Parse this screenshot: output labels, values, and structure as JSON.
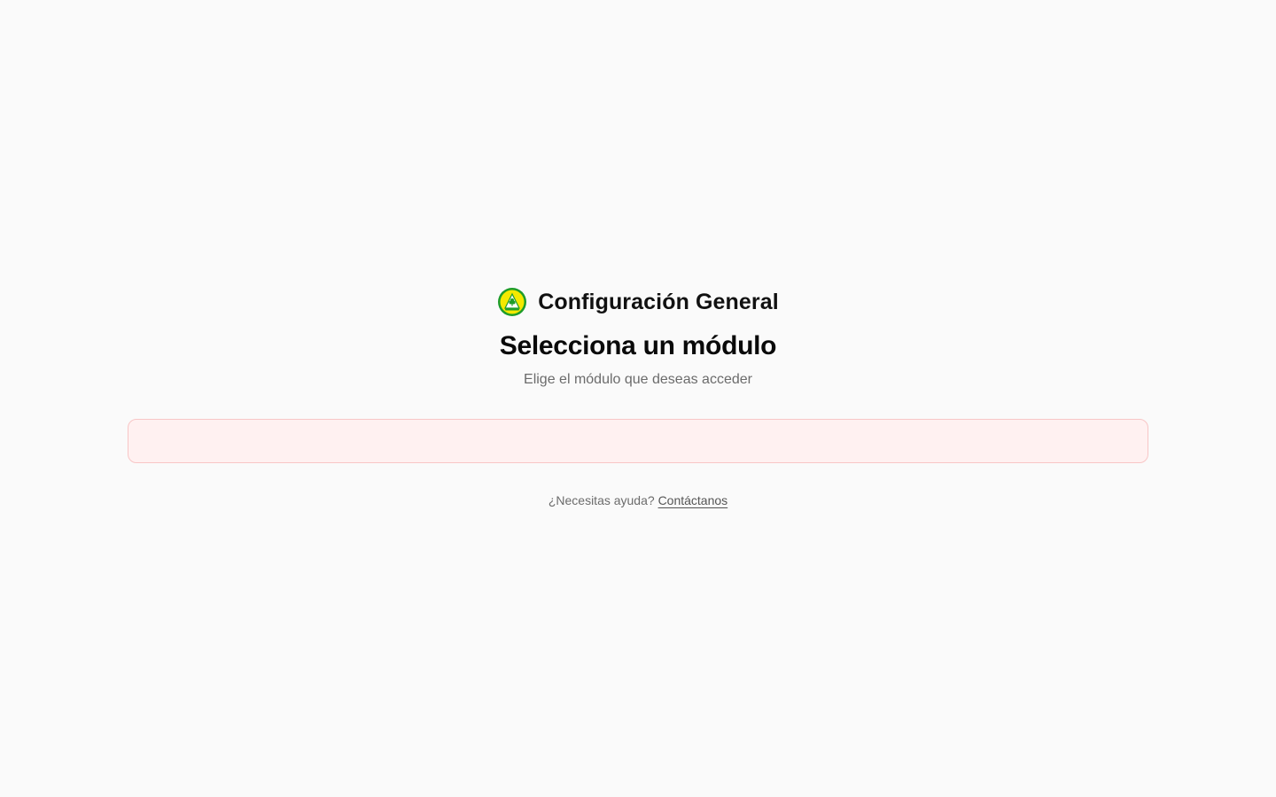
{
  "header": {
    "logo_icon": "cooperative-logo-icon",
    "app_title": "Configuración General"
  },
  "main": {
    "heading": "Selecciona un módulo",
    "subheading": "Elige el módulo que deseas acceder"
  },
  "modules_panel": {
    "background_color": "#fff1f1",
    "border_color": "#f8c6c6"
  },
  "footer": {
    "help_text": "¿Necesitas ayuda?",
    "contact_link": "Contáctanos"
  }
}
